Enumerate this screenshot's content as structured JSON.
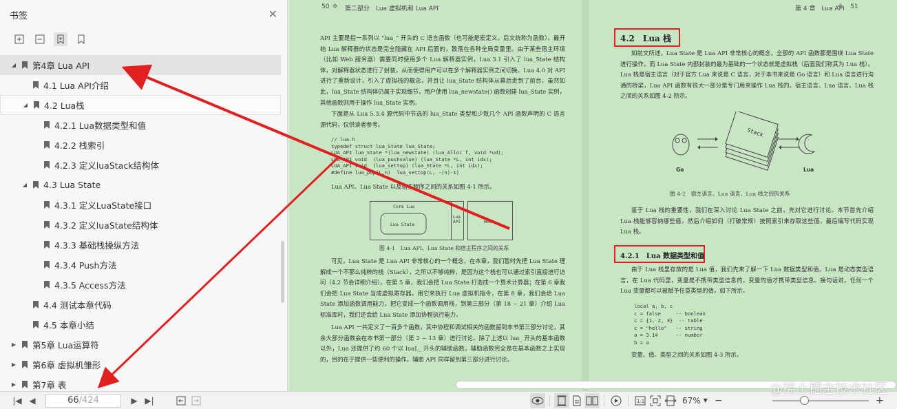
{
  "sidebar": {
    "title": "书签",
    "tree": [
      {
        "label": "第4章 Lua API",
        "level": 0,
        "expanded": true,
        "selected": true
      },
      {
        "label": "4.1 Lua API介绍",
        "level": 1
      },
      {
        "label": "4.2 Lua栈",
        "level": 1,
        "expanded": true,
        "hovered": true
      },
      {
        "label": "4.2.1 Lua数据类型和值",
        "level": 2
      },
      {
        "label": "4.2.2 栈索引",
        "level": 2
      },
      {
        "label": "4.2.3 定义luaStack结构体",
        "level": 2
      },
      {
        "label": "4.3 Lua State",
        "level": 1,
        "expanded": true
      },
      {
        "label": "4.3.1 定义LuaState接口",
        "level": 2
      },
      {
        "label": "4.3.2 定义luaState结构体",
        "level": 2
      },
      {
        "label": "4.3.3 基础栈操纵方法",
        "level": 2
      },
      {
        "label": "4.3.4 Push方法",
        "level": 2
      },
      {
        "label": "4.3.5 Access方法",
        "level": 2
      },
      {
        "label": "4.4 测试本章代码",
        "level": 1
      },
      {
        "label": "4.5 本章小结",
        "level": 1
      },
      {
        "label": "第5章 Lua运算符",
        "level": 0,
        "collapsed": true
      },
      {
        "label": "第6章 虚拟机雏形",
        "level": 0,
        "collapsed": true
      },
      {
        "label": "第7章 表",
        "level": 0,
        "collapsed": true
      }
    ]
  },
  "left_page": {
    "page_number": "50",
    "running_head": "第二部分　Lua 虚拟机和 Lua API",
    "para1": "API 主要是指一系列以 \"lua_\" 开头的 C 语言函数（也可能是宏定义，后文统称为函数）。最开始 Lua 解释器的状态是完全隐藏在 API 后面的，散落在各种全局变量里。由于某些宿主环境（比如 Web 服务器）需要同时使用多个 Lua 解释器实例，Lua 3.1 引入了 lua_State 结构体，对解释器状态进行了封装，从而使得用户可以在多个解释器实例之间切换。Lua 4.0 对 API 进行了重新设计，引入了虚拟栈的概念，并且让 lua_State 结构体从幕后走到了前台。虽然如此，lua_State 结构体仍属于实现细节，用户使用 lua_newstate() 函数创建 lua_State 实例，其他函数则用于操作 lua_State 实例。",
    "para2": "下面是从 Lua 5.3.4 源代码中节选的 lua_State 类型和少数几个 API 函数声明的 C 语言源代码，仅供读者参考。",
    "code": "// lua.h\ntypedef struct lua_State lua_State;\nLUA_API lua_State *(lua_newstate) (lua_Alloc f, void *ud);\nLUA_API void  (lua_pushvalue) (lua_State *L, int idx);\nLUA_API void  (lua_settop) (lua_State *L, int idx);\n#define lua_pop(L,n)  lua_settop(L, -(n)-1)",
    "para3": "Lua API、Lua State 以及宿主程序之间的关系如图 4-1 所示。",
    "fig_core": "Core Lua",
    "fig_state": "Lua State",
    "fig_api": "Lua\nAPI",
    "fig_host": "Host",
    "fig_caption": "图 4-1　Lua API、Lua State 和宿主程序之间的关系",
    "para4": "可见，Lua State 是 Lua API 非常核心的一个概念，在本章，我们暂时先把 Lua State 理解成一个不那么纯粹的栈（Stack），之所以不够纯粹，是因为这个栈也可以通过索引直接进行访问（4.2 节会详细介绍）。在第 5 章，我们会把 Lua State 打造成一个算术计算器；在第 6 章我们会把 Lua State 当成虚拟寄存器，用它来执行 Lua 虚拟机指令，在第 8 章，我们会给 Lua State 添加函数调用能力，把它变成一个函数调用栈，到第三部分（第 18 ~ 21 章）介绍 Lua 标准库时，我们还会给 Lua State 添加协程执行能力。",
    "para5": "Lua API 一共定义了一百多个函数，其中协程和调试相关的函数留到本书第三部分讨论，其余大部分函数会在本书第一部分（第 2 ~ 13 章）进行讨论。除了上述以 lua_ 开头的基本函数以外，Lua 还提供了约 60 个以 luaL_ 开头的辅助函数。辅助函数完全是在基本函数之上实现的，目的在于提供一些便利的操作。辅助 API 同样留到第三部分进行讨论。"
  },
  "right_page": {
    "page_number": "51",
    "running_head": "第 4 章　Lua API",
    "heading1": "4.2　Lua 栈",
    "para1": "如前文所述，Lua State 是 Lua API 非常核心的概念，全部的 API 函数都是围绕 Lua State 进行操作，而 Lua State 内部封装的最为基础的一个状态就是虚拟栈（后面我们称其为 Lua 栈）。Lua 栈是宿主语言（对于官方 Lua 来说是 C 语言，对于本书来说是 Go 语言）和 Lua 语言进行沟通的桥梁，Lua API 函数有很大一部分是专门用来操作 Lua 栈的。宿主语言、Lua 语言、Lua 栈之间的关系如图 4-2 所示。",
    "fig_stack": "Stack",
    "fig_go": "Go",
    "fig_lua": "Lua",
    "fig_caption": "图 4-2　宿主语言、Lua 语言、Lua 栈之间的关系",
    "para2": "鉴于 Lua 栈的重要性，我们在深入讨论 Lua State 之前，先对它进行讨论。本节首先介绍 Lua 栈能够容纳哪些值，然后介绍如何（打破常规）按照索引来存取这些值，最后编写代码实现 Lua 栈。",
    "heading2": "4.2.1　Lua 数据类型和值",
    "para3": "由于 Lua 栈里存放的是 Lua 值，我们先来了解一下 Lua 数据类型和值。Lua 是动态类型语言，在 Lua 代码里，变量是不携带类型信息的，变量的值才携带类型信息。换句话说，任何一个 Lua 变量都可以被赋予任意类型的值，如下所示。",
    "code": "local a, b, c\nc = false     -- boolean\nc = {1, 2, 3}  -- table\nc = \"hello\"   -- string\na = 3.14      -- number\nb = a",
    "para4": "变量、值、类型之间的关系如图 4-3 所示。"
  },
  "bottombar": {
    "current_page": "66",
    "total_pages": "/424",
    "zoom": "67%",
    "zoom_minus": "−",
    "zoom_plus": "+",
    "watermark": "@稀土掘金技术社区"
  },
  "colors": {
    "page_bg": "#c8e6c4",
    "annotation_red": "#e02020"
  }
}
